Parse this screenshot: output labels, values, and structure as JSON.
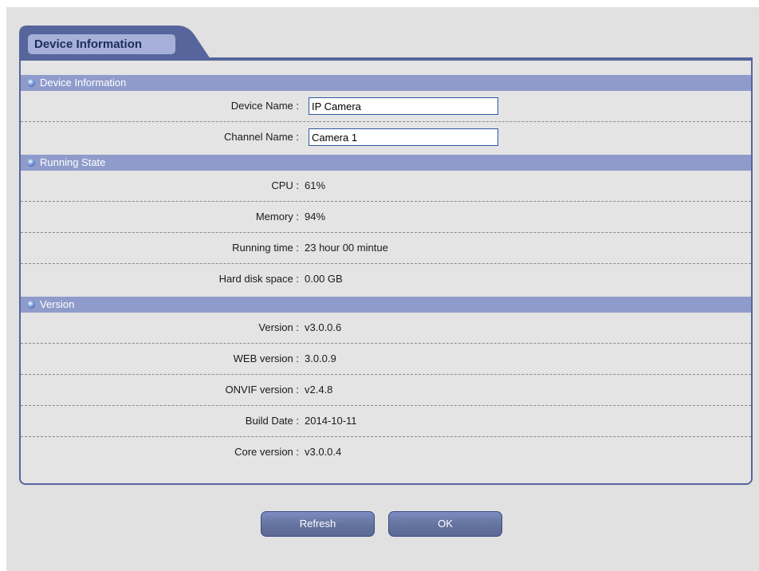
{
  "tab": {
    "title": "Device Information"
  },
  "sections": {
    "device_info": {
      "title": "Device Information",
      "device_name_label": "Device Name :",
      "device_name_value": "IP Camera",
      "channel_name_label": "Channel Name :",
      "channel_name_value": "Camera 1"
    },
    "running_state": {
      "title": "Running State",
      "cpu_label": "CPU :",
      "cpu_value": "61%",
      "memory_label": "Memory :",
      "memory_value": "94%",
      "running_time_label": "Running time :",
      "running_time_value": "23 hour 00 mintue",
      "disk_label": "Hard disk space :",
      "disk_value": "0.00 GB"
    },
    "version": {
      "title": "Version",
      "version_label": "Version :",
      "version_value": "v3.0.0.6",
      "web_label": "WEB version :",
      "web_value": "3.0.0.9",
      "onvif_label": "ONVIF version :",
      "onvif_value": "v2.4.8",
      "build_label": "Build Date :",
      "build_value": "2014-10-11",
      "core_label": "Core version :",
      "core_value": "v3.0.0.4"
    }
  },
  "buttons": {
    "refresh": "Refresh",
    "ok": "OK"
  },
  "colors": {
    "header_bar": "#8f9ccb",
    "panel_border": "#56659b",
    "input_border": "#2c58a0",
    "button": "#66759f"
  },
  "icons": {
    "section_bullet": "blue-circle-bullet-icon"
  }
}
